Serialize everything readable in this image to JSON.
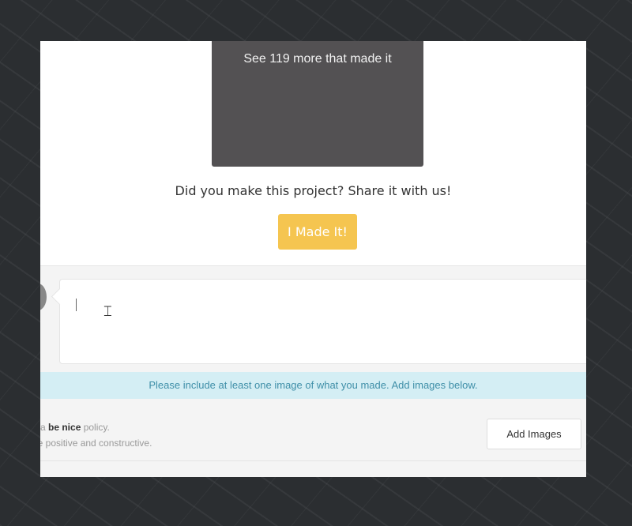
{
  "gallery": {
    "more_label": "See 119 more that made it"
  },
  "prompt": "Did you make this project? Share it with us!",
  "made_button": "I Made It!",
  "comment": {
    "value": ""
  },
  "info": "Please include at least one image of what you made. Add images below.",
  "policy": {
    "pre": "e a ",
    "bold": "be nice",
    "post": " policy.",
    "line2": "be positive and constructive."
  },
  "add_images": "Add Images"
}
